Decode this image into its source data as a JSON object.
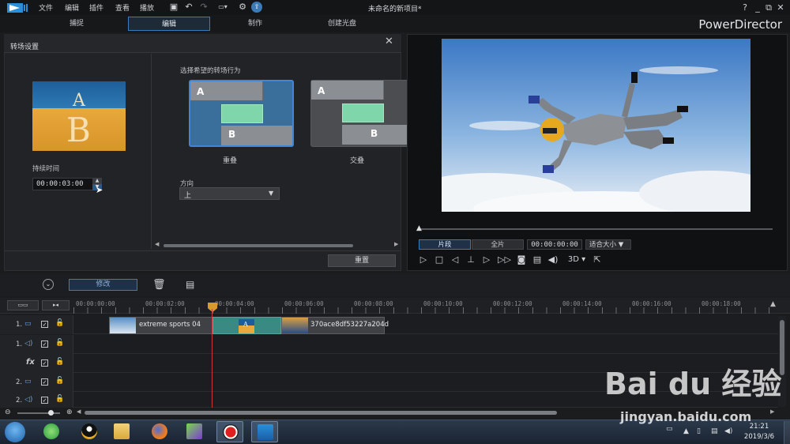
{
  "app": {
    "menu": [
      "文件",
      "编辑",
      "插件",
      "查看",
      "播放"
    ],
    "document_title": "未命名的新项目*",
    "brand": "PowerDirector",
    "help": "?",
    "window_controls": [
      "_",
      "⧉",
      "✕"
    ]
  },
  "tabs": [
    {
      "label": "捕捉"
    },
    {
      "label": "编辑",
      "active": true
    },
    {
      "label": "制作"
    },
    {
      "label": "创建光盘"
    }
  ],
  "transition_panel": {
    "title": "转场设置",
    "close": "✕",
    "thumb_top_letter": "A",
    "thumb_bottom_letter": "B",
    "duration_label": "持续时间",
    "duration_value": "00:00:03:00",
    "behavior_label": "选择希望的转场行为",
    "card_letter_a": "A",
    "card_letter_b": "B",
    "options": [
      {
        "label": "重叠",
        "selected": true
      },
      {
        "label": "交叠",
        "selected": false
      }
    ],
    "direction_label": "方向",
    "direction_value": "上",
    "reset_label": "重置"
  },
  "preview": {
    "clip_label": "片段",
    "full_label": "全片",
    "timecode": "00:00:00:00",
    "fit_label": "适合大小",
    "mode_3d": "3D"
  },
  "toolbar": {
    "modify_label": "修改"
  },
  "timeline": {
    "ruler_ticks": [
      "00:00:00:00",
      "00:00:02:00",
      "00:00:04:00",
      "00:00:06:00",
      "00:00:08:00",
      "00:00:10:00",
      "00:00:12:00",
      "00:00:14:00",
      "00:00:16:00",
      "00:00:18:00"
    ],
    "tracks": [
      {
        "num": "1.",
        "type": "video"
      },
      {
        "num": "1.",
        "type": "audio"
      },
      {
        "num": "fx",
        "type": "fx"
      },
      {
        "num": "2.",
        "type": "video"
      },
      {
        "num": "2.",
        "type": "audio"
      }
    ],
    "clips": [
      {
        "label": "extreme sports 04"
      },
      {
        "label": "370ace8df53227a204d"
      }
    ],
    "transition_thumb_letter": "A"
  },
  "taskbar": {
    "time": "21:21",
    "date": "2019/3/6"
  },
  "watermark": {
    "text": "Bai du 经验",
    "url": "jingyan.baidu.com"
  }
}
